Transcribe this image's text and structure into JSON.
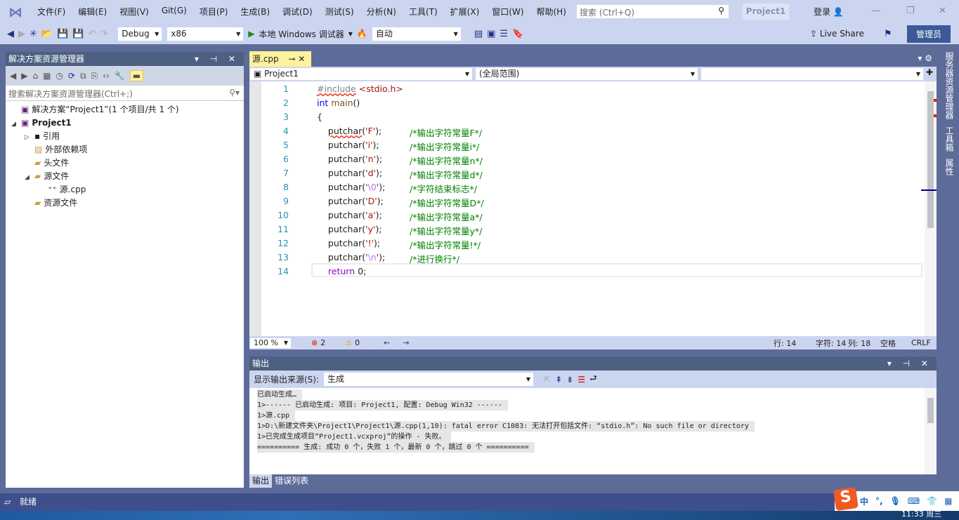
{
  "menubar": {
    "items": [
      "文件(F)",
      "编辑(E)",
      "视图(V)",
      "Git(G)",
      "项目(P)",
      "生成(B)",
      "调试(D)",
      "测试(S)",
      "分析(N)",
      "工具(T)",
      "扩展(X)",
      "窗口(W)",
      "帮助(H)"
    ],
    "search_placeholder": "搜索 (Ctrl+Q)",
    "project": "Project1",
    "login": "登录"
  },
  "toolbar": {
    "config": "Debug",
    "platform": "x86",
    "run": "本地 Windows 调试器",
    "auto": "自动",
    "live_share": "Live Share",
    "admin": "管理员"
  },
  "solution_explorer": {
    "title": "解决方案资源管理器",
    "search_placeholder": "搜索解决方案资源管理器(Ctrl+;)",
    "tree": [
      {
        "label": "解决方案“Project1”(1 个项目/共 1 个)",
        "level": 0,
        "expander": ""
      },
      {
        "label": "Project1",
        "level": 0,
        "expander": "◢",
        "bold": true
      },
      {
        "label": "引用",
        "level": 1,
        "expander": "▷"
      },
      {
        "label": "外部依赖项",
        "level": 1,
        "expander": ""
      },
      {
        "label": "头文件",
        "level": 1,
        "expander": ""
      },
      {
        "label": "源文件",
        "level": 1,
        "expander": "◢"
      },
      {
        "label": "源.cpp",
        "level": 2,
        "expander": ""
      },
      {
        "label": "资源文件",
        "level": 1,
        "expander": ""
      }
    ]
  },
  "editor": {
    "tab": "源.cpp",
    "nav": [
      "Project1",
      "(全局范围)",
      ""
    ],
    "status": {
      "zoom": "100 %",
      "errors": "2",
      "warnings": "0",
      "line": "行: 14",
      "char": "字符: 14",
      "col": "列: 18",
      "space": "空格",
      "eol": "CRLF"
    }
  },
  "output": {
    "title": "输出",
    "source_label": "显示输出来源(S):",
    "source": "生成",
    "lines": [
      "已启动生成…",
      "1>------ 已启动生成: 项目: Project1, 配置: Debug Win32 ------",
      "1>源.cpp",
      "1>D:\\新建文件夹\\Project1\\Project1\\源.cpp(1,10): fatal error C1083: 无法打开包括文件: “stdio.h”: No such file or directory",
      "1>已完成生成项目“Project1.vcxproj”的操作 - 失败。",
      "========== 生成: 成功 0 个，失败 1 个，最新 0 个，跳过 0 个 =========="
    ],
    "tabs": [
      "输出",
      "错误列表"
    ]
  },
  "right_tabs": [
    "服务器资源管理器",
    "工具箱",
    "属性"
  ],
  "status": {
    "text": "就绪"
  },
  "ime": {
    "items": [
      "中",
      "°,",
      "🎤",
      "⌨",
      "👕",
      "▦"
    ]
  },
  "taskbar": {
    "time": "11:33 周三"
  }
}
